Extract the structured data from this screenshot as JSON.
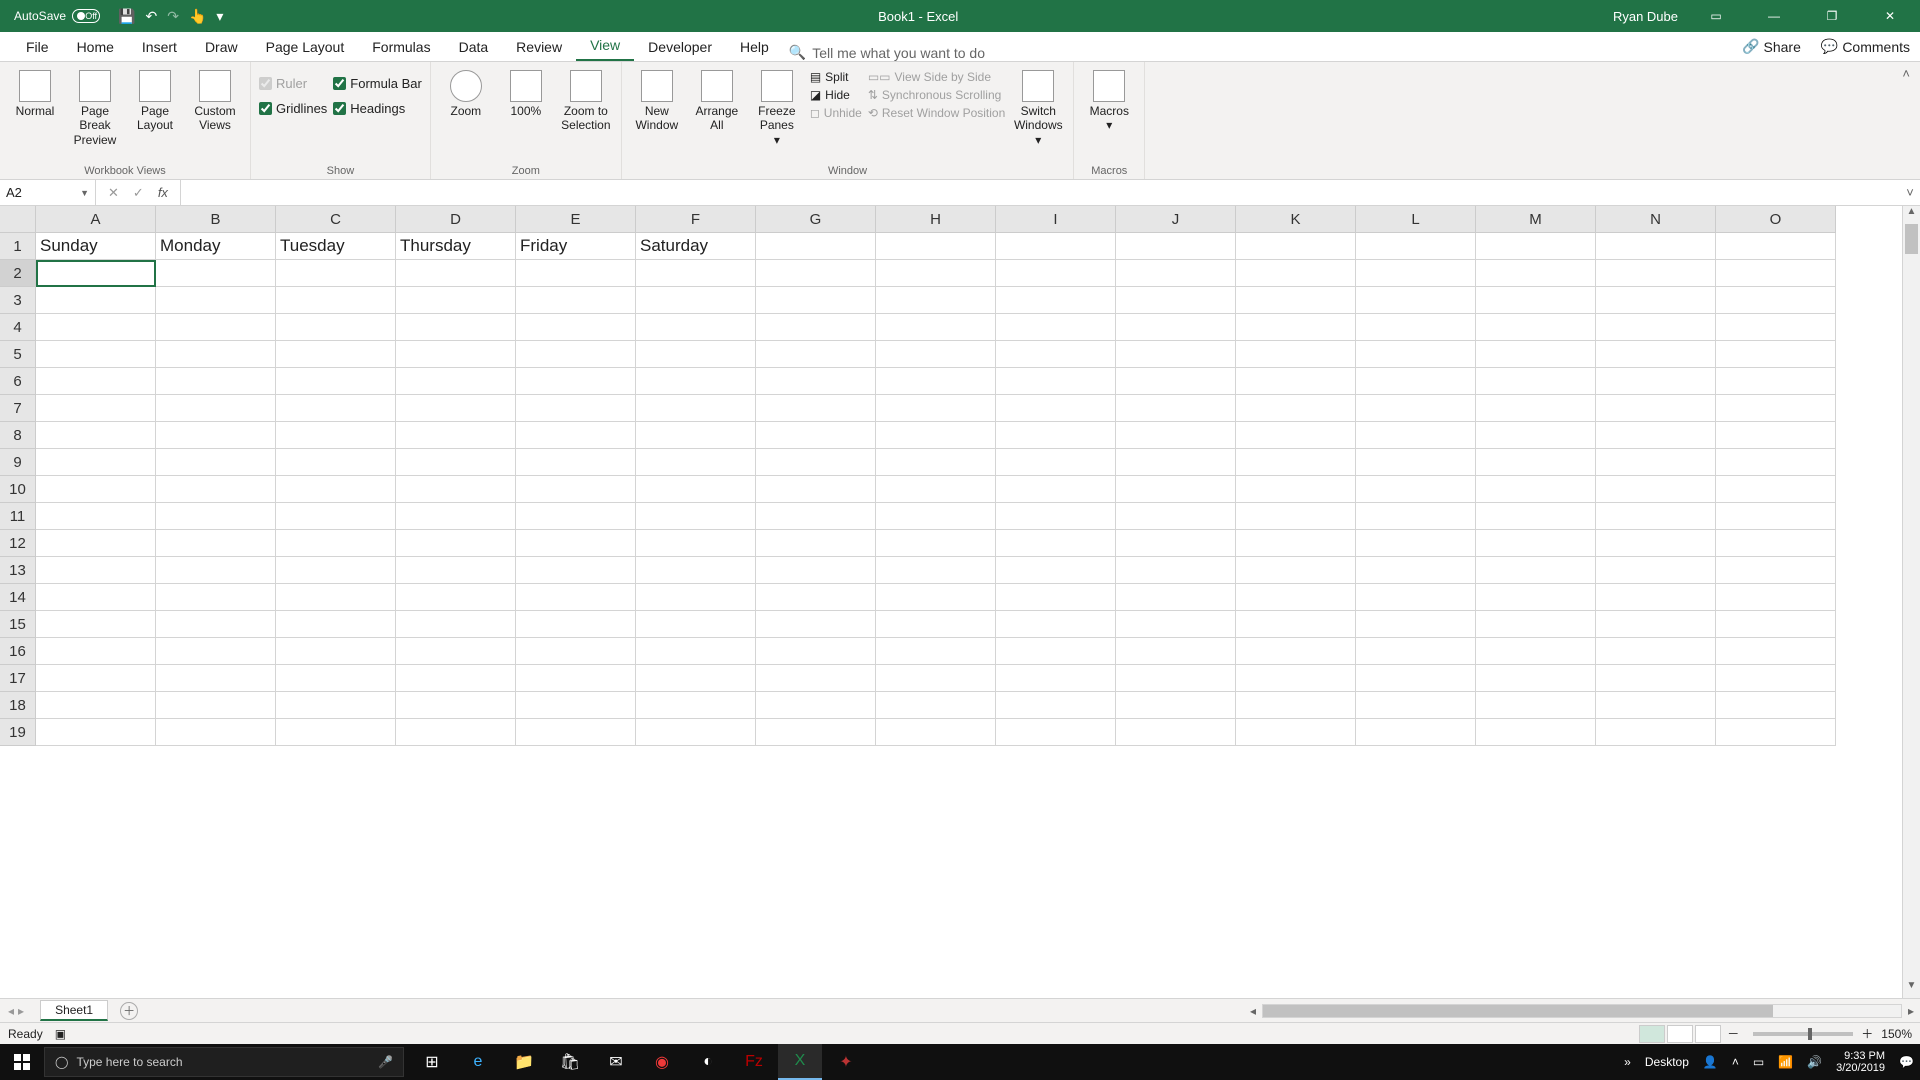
{
  "titlebar": {
    "autosave_label": "AutoSave",
    "autosave_state": "Off",
    "document_title": "Book1 - Excel",
    "user_name": "Ryan Dube"
  },
  "ribbon_tabs": {
    "file": "File",
    "home": "Home",
    "insert": "Insert",
    "draw": "Draw",
    "page_layout": "Page Layout",
    "formulas": "Formulas",
    "data": "Data",
    "review": "Review",
    "view": "View",
    "developer": "Developer",
    "help": "Help",
    "tell_me": "Tell me what you want to do",
    "share": "Share",
    "comments": "Comments"
  },
  "ribbon": {
    "workbook_views": {
      "label": "Workbook Views",
      "normal": "Normal",
      "page_break": "Page Break Preview",
      "page_layout": "Page Layout",
      "custom_views": "Custom Views"
    },
    "show": {
      "label": "Show",
      "ruler": "Ruler",
      "formula_bar": "Formula Bar",
      "gridlines": "Gridlines",
      "headings": "Headings"
    },
    "zoom": {
      "label": "Zoom",
      "zoom": "Zoom",
      "hundred": "100%",
      "to_selection": "Zoom to Selection"
    },
    "window": {
      "label": "Window",
      "new_window": "New Window",
      "arrange_all": "Arrange All",
      "freeze_panes": "Freeze Panes",
      "split": "Split",
      "hide": "Hide",
      "unhide": "Unhide",
      "side_by_side": "View Side by Side",
      "sync_scroll": "Synchronous Scrolling",
      "reset_pos": "Reset Window Position",
      "switch": "Switch Windows"
    },
    "macros": {
      "label": "Macros",
      "macros": "Macros"
    }
  },
  "formula_bar": {
    "name_box": "A2",
    "formula": ""
  },
  "grid": {
    "columns": [
      "A",
      "B",
      "C",
      "D",
      "E",
      "F",
      "G",
      "H",
      "I",
      "J",
      "K",
      "L",
      "M",
      "N",
      "O"
    ],
    "row_count": 19,
    "selected_cell": "A2",
    "data": {
      "A1": "Sunday",
      "B1": "Monday",
      "C1": "Tuesday",
      "D1": "Thursday",
      "E1": "Friday",
      "F1": "Saturday"
    }
  },
  "sheet_tabs": {
    "sheet1": "Sheet1"
  },
  "status": {
    "ready": "Ready",
    "zoom_pct": "150%"
  },
  "taskbar": {
    "search_placeholder": "Type here to search",
    "desktop": "Desktop",
    "time": "9:33 PM",
    "date": "3/20/2019"
  }
}
